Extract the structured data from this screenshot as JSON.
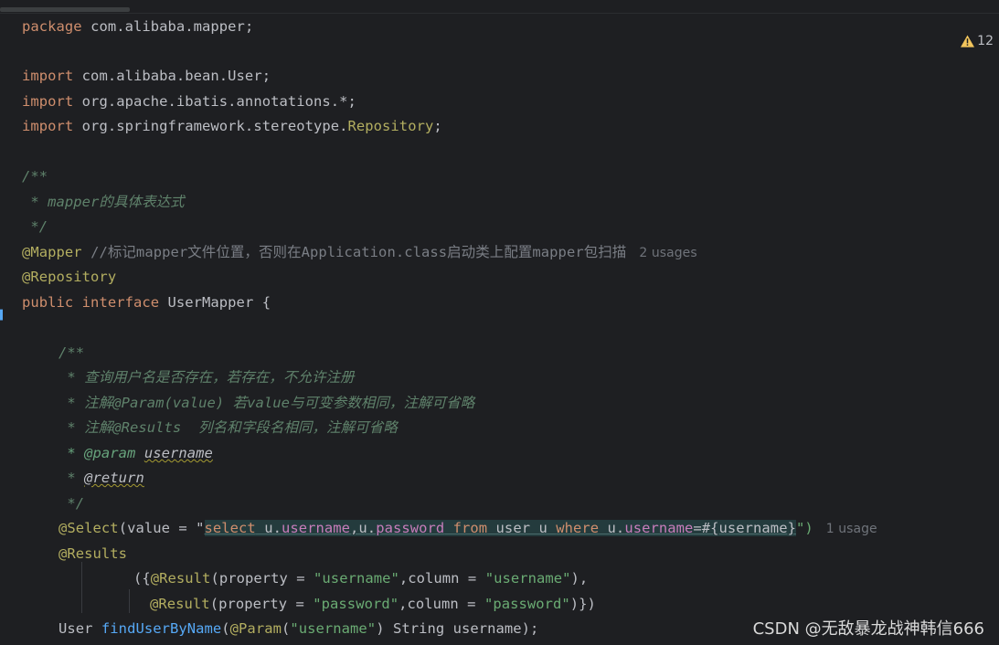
{
  "editor": {
    "warning_count": "12",
    "lines": {
      "l1_kw": "package",
      "l1_rest": " com.alibaba.mapper;",
      "l3_kw": "import",
      "l3_rest": " com.alibaba.bean.User;",
      "l4_kw": "import",
      "l4_rest": " org.apache.ibatis.annotations.*;",
      "l5_kw": "import",
      "l5_rest": " org.springframework.stereotype.",
      "l5_cls": "Repository",
      "l5_end": ";",
      "l7": "/**",
      "l8": " * mapper的具体表达式",
      "l9": " */",
      "l10_ann": "@Mapper",
      "l10_cmt": " //标记mapper文件位置，否则在Application.class启动类上配置mapper包扫描",
      "l10_hint": "2 usages",
      "l11_ann": "@Repository",
      "l12_kw1": "public",
      "l12_kw2": " interface",
      "l12_rest": " UserMapper {",
      "l14": "/**",
      "l15": " * 查询用户名是否存在，若存在，不允许注册",
      "l16": " * 注解@Param(value) 若value与可变参数相同，注解可省略",
      "l17": " * 注解@Results  列名和字段名相同，注解可省略",
      "l18_tag": " * @param",
      "l18_ref": "username",
      "l19_star": " * ",
      "l19_tag": "@return",
      "l20": " */",
      "l21_ann": "@Select",
      "l21_a": "(value = \"",
      "l21_s1": "select",
      "l21_s2": " u.",
      "l21_s3": "username",
      "l21_s4": ",u.",
      "l21_s5": "password",
      "l21_s6": " from",
      "l21_s7": " user u ",
      "l21_s8": "where",
      "l21_s9": " u.",
      "l21_s10": "username",
      "l21_s11": "=#{username}",
      "l21_b": "\")",
      "l21_hint": "1 usage",
      "l22_ann": "@Results",
      "l23_a": "({",
      "l23_ann": "@Result",
      "l23_b": "(property = ",
      "l23_s1": "\"username\"",
      "l23_c": ",column = ",
      "l23_s2": "\"username\"",
      "l23_d": "),",
      "l24_ann": "@Result",
      "l24_b": "(property = ",
      "l24_s1": "\"password\"",
      "l24_c": ",column = ",
      "l24_s2": "\"password\"",
      "l24_d": ")})",
      "l25_a": "User ",
      "l25_fn": "findUserByName",
      "l25_b": "(",
      "l25_ann": "@Param",
      "l25_c": "(",
      "l25_s": "\"username\"",
      "l25_d": ") String username);"
    }
  },
  "watermark": "CSDN @无敌暴龙战神韩信666",
  "colors": {
    "background": "#1e1f22",
    "keyword": "#cf8e6d",
    "annotation": "#b3ae60",
    "string": "#6aab73",
    "doc_comment": "#5f826b",
    "function": "#56a8f5"
  }
}
